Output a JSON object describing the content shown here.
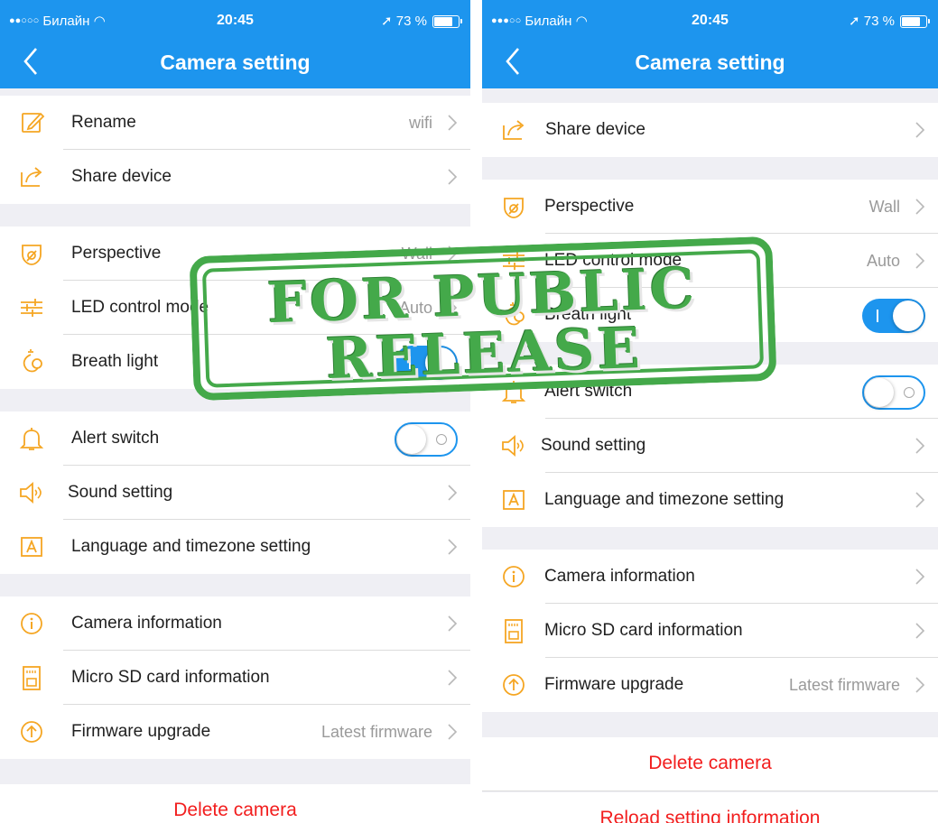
{
  "left_screen": {
    "status": {
      "carrier": "Билайн",
      "signal": "●●○○○",
      "time": "20:45",
      "battery": "73 %"
    },
    "title": "Camera setting",
    "rows": {
      "rename": {
        "label": "Rename",
        "value": "wifi"
      },
      "share": {
        "label": "Share device"
      },
      "perspective": {
        "label": "Perspective",
        "value": "Wall"
      },
      "led": {
        "label": "LED control mode",
        "value": "Auto"
      },
      "breath": {
        "label": "Breath light",
        "state": "on"
      },
      "alert": {
        "label": "Alert switch",
        "state": "off"
      },
      "sound": {
        "label": "Sound setting"
      },
      "language": {
        "label": "Language and timezone setting"
      },
      "camera_info": {
        "label": "Camera information"
      },
      "sd": {
        "label": "Micro SD card information"
      },
      "firmware": {
        "label": "Firmware upgrade",
        "value": "Latest firmware"
      }
    },
    "delete": "Delete camera"
  },
  "right_screen": {
    "status": {
      "carrier": "Билайн",
      "signal": "●●●○○",
      "time": "20:45",
      "battery": "73 %"
    },
    "title": "Camera setting",
    "rows": {
      "share": {
        "label": "Share device"
      },
      "perspective": {
        "label": "Perspective",
        "value": "Wall"
      },
      "led": {
        "label": "LED control mode",
        "value": "Auto"
      },
      "breath": {
        "label": "Breath light",
        "state": "on"
      },
      "alert": {
        "label": "Alert switch",
        "state": "off"
      },
      "sound": {
        "label": "Sound setting"
      },
      "language": {
        "label": "Language and timezone setting"
      },
      "camera_info": {
        "label": "Camera information"
      },
      "sd": {
        "label": "Micro SD card information"
      },
      "firmware": {
        "label": "Firmware upgrade",
        "value": "Latest firmware"
      }
    },
    "delete": "Delete camera",
    "reload": "Reload setting information"
  },
  "stamp": {
    "line1": "FOR PUBLIC",
    "line2": "RELEASE"
  },
  "colors": {
    "header": "#1d95ee",
    "icon": "#f5a623",
    "danger": "#f21e1e",
    "stamp": "#44a94a"
  }
}
